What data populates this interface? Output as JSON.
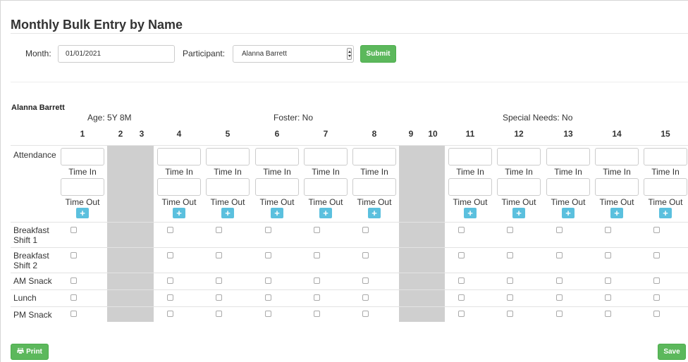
{
  "page": {
    "title": "Monthly Bulk Entry by Name"
  },
  "form": {
    "month_label": "Month:",
    "month_value": "01/01/2021",
    "participant_label": "Participant:",
    "participant_value": "Alanna Barrett",
    "submit_label": "Submit"
  },
  "participant": {
    "name": "Alanna Barrett",
    "age": "Age: 5Y 8M",
    "foster": "Foster: No",
    "special_needs": "Special Needs: No"
  },
  "days": [
    "1",
    "2",
    "3",
    "4",
    "5",
    "6",
    "7",
    "8",
    "9",
    "10",
    "11",
    "12",
    "13",
    "14",
    "15"
  ],
  "closed_days": [
    "2",
    "3",
    "9",
    "10"
  ],
  "rows": {
    "attendance": "Attendance",
    "time_in": "Time In",
    "time_out": "Time Out",
    "add": "+",
    "meals": [
      "Breakfast\nShift 1",
      "Breakfast\nShift 2",
      "AM Snack",
      "Lunch",
      "PM Snack"
    ]
  },
  "footer": {
    "print_label": "Print",
    "save_label": "Save"
  },
  "colors": {
    "green": "#5cb85c",
    "info_blue": "#5bc0de",
    "closed_gray": "#cfcfcf"
  },
  "icons": {
    "print": "printer-icon",
    "select": "select-arrows-icon"
  }
}
